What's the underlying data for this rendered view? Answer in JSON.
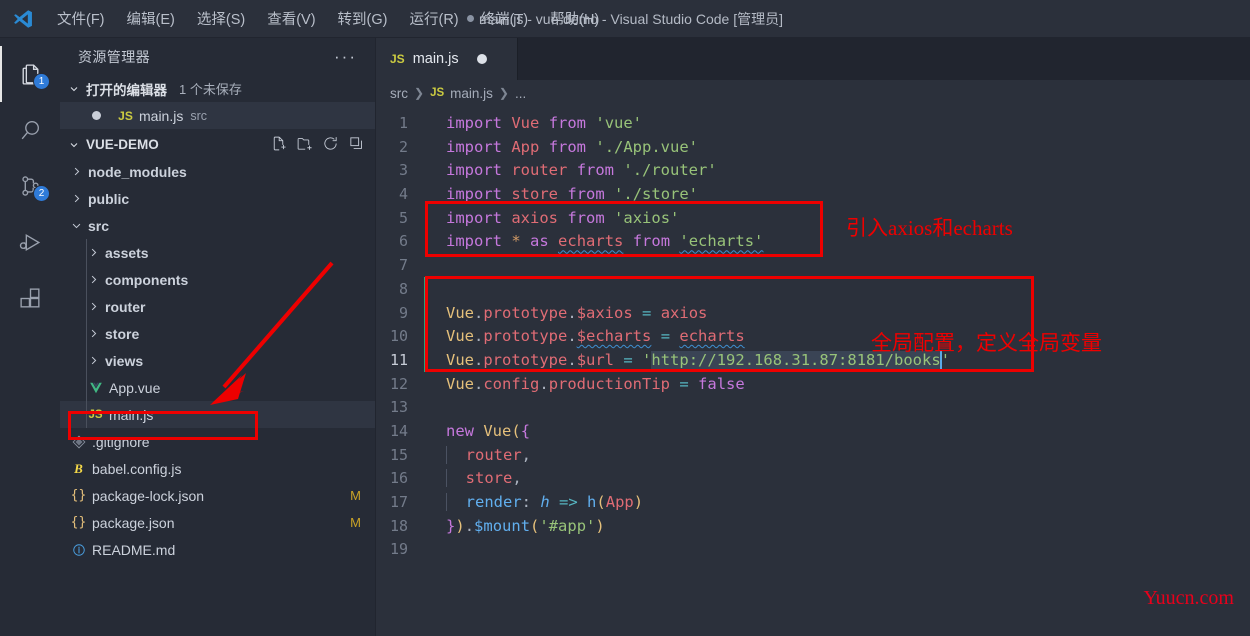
{
  "titlebar": {
    "logo_icon": "vscode-logo-icon",
    "menus": [
      {
        "label": "文件(F)",
        "name": "menu-file"
      },
      {
        "label": "编辑(E)",
        "name": "menu-edit"
      },
      {
        "label": "选择(S)",
        "name": "menu-selection"
      },
      {
        "label": "查看(V)",
        "name": "menu-view"
      },
      {
        "label": "转到(G)",
        "name": "menu-goto"
      },
      {
        "label": "运行(R)",
        "name": "menu-run"
      },
      {
        "label": "终端(T)",
        "name": "menu-terminal"
      },
      {
        "label": "帮助(H)",
        "name": "menu-help"
      }
    ],
    "window_title": "main.js - vue-demo - Visual Studio Code [管理员]"
  },
  "activitybar": {
    "items": [
      {
        "icon": "files-explorer-icon",
        "badge": "1",
        "active": true
      },
      {
        "icon": "search-icon",
        "badge": "",
        "active": false
      },
      {
        "icon": "source-control-icon",
        "badge": "2",
        "active": false
      },
      {
        "icon": "run-and-debug-icon",
        "badge": "",
        "active": false
      },
      {
        "icon": "extensions-icon",
        "badge": "",
        "active": false
      }
    ]
  },
  "sidebar": {
    "title": "资源管理器",
    "more_actions": "···",
    "open_editors": {
      "label": "打开的编辑器",
      "sublabel": "1 个未保存",
      "items": [
        {
          "name": "main.js",
          "folder": "src",
          "icon": "js-file-icon",
          "dirty": true,
          "selected": true
        }
      ]
    },
    "project": {
      "label": "VUE-DEMO",
      "actions": [
        "new-file-icon",
        "new-folder-icon",
        "refresh-icon",
        "collapse-all-icon"
      ],
      "tree": [
        {
          "label": "node_modules",
          "type": "folder",
          "depth": 0,
          "expanded": false,
          "badge": ""
        },
        {
          "label": "public",
          "type": "folder",
          "depth": 0,
          "expanded": false,
          "badge": ""
        },
        {
          "label": "src",
          "type": "folder",
          "depth": 0,
          "expanded": true,
          "badge": ""
        },
        {
          "label": "assets",
          "type": "folder",
          "depth": 1,
          "expanded": false,
          "badge": ""
        },
        {
          "label": "components",
          "type": "folder",
          "depth": 1,
          "expanded": false,
          "badge": ""
        },
        {
          "label": "router",
          "type": "folder",
          "depth": 1,
          "expanded": false,
          "badge": ""
        },
        {
          "label": "store",
          "type": "folder",
          "depth": 1,
          "expanded": false,
          "badge": ""
        },
        {
          "label": "views",
          "type": "folder",
          "depth": 1,
          "expanded": false,
          "badge": ""
        },
        {
          "label": "App.vue",
          "type": "vue",
          "depth": 1,
          "expanded": false,
          "badge": ""
        },
        {
          "label": "main.js",
          "type": "js",
          "depth": 1,
          "expanded": false,
          "badge": "",
          "selected": true,
          "highlighted": true
        },
        {
          "label": ".gitignore",
          "type": "git",
          "depth": 0,
          "expanded": false,
          "badge": ""
        },
        {
          "label": "babel.config.js",
          "type": "babel",
          "depth": 0,
          "expanded": false,
          "badge": ""
        },
        {
          "label": "package-lock.json",
          "type": "json",
          "depth": 0,
          "expanded": false,
          "badge": "M"
        },
        {
          "label": "package.json",
          "type": "json",
          "depth": 0,
          "expanded": false,
          "badge": "M"
        },
        {
          "label": "README.md",
          "type": "md",
          "depth": 0,
          "expanded": false,
          "badge": ""
        }
      ]
    }
  },
  "editor": {
    "tabs": [
      {
        "label": "main.js",
        "icon": "js-file-icon",
        "dirty": true,
        "active": true
      }
    ],
    "breadcrumb": [
      "src",
      "main.js",
      "..."
    ],
    "filename": "main.js",
    "lines": [
      {
        "n": "1",
        "text": "import Vue from 'vue'"
      },
      {
        "n": "2",
        "text": "import App from './App.vue'"
      },
      {
        "n": "3",
        "text": "import router from './router'"
      },
      {
        "n": "4",
        "text": "import store from './store'"
      },
      {
        "n": "5",
        "text": "import axios from 'axios'"
      },
      {
        "n": "6",
        "text": "import * as echarts from 'echarts'"
      },
      {
        "n": "7",
        "text": ""
      },
      {
        "n": "8",
        "text": ""
      },
      {
        "n": "9",
        "text": "Vue.prototype.$axios = axios"
      },
      {
        "n": "10",
        "text": "Vue.prototype.$echarts = echarts"
      },
      {
        "n": "11",
        "text": "Vue.prototype.$url = 'http://192.168.31.87:8181/books'"
      },
      {
        "n": "12",
        "text": "Vue.config.productionTip = false"
      },
      {
        "n": "13",
        "text": ""
      },
      {
        "n": "14",
        "text": "new Vue({"
      },
      {
        "n": "15",
        "text": "  router,"
      },
      {
        "n": "16",
        "text": "  store,"
      },
      {
        "n": "17",
        "text": "  render: h => h(App)"
      },
      {
        "n": "18",
        "text": "}).$mount('#app')"
      },
      {
        "n": "19",
        "text": ""
      }
    ],
    "current_line": "11",
    "selected_text": "http://192.168.31.87:8181/books"
  },
  "annotations": {
    "note_imports": "引入axios和echarts",
    "note_globals": "全局配置，定义全局变量",
    "watermark": "Yuucn.com",
    "accent_red": "#ee0000"
  }
}
